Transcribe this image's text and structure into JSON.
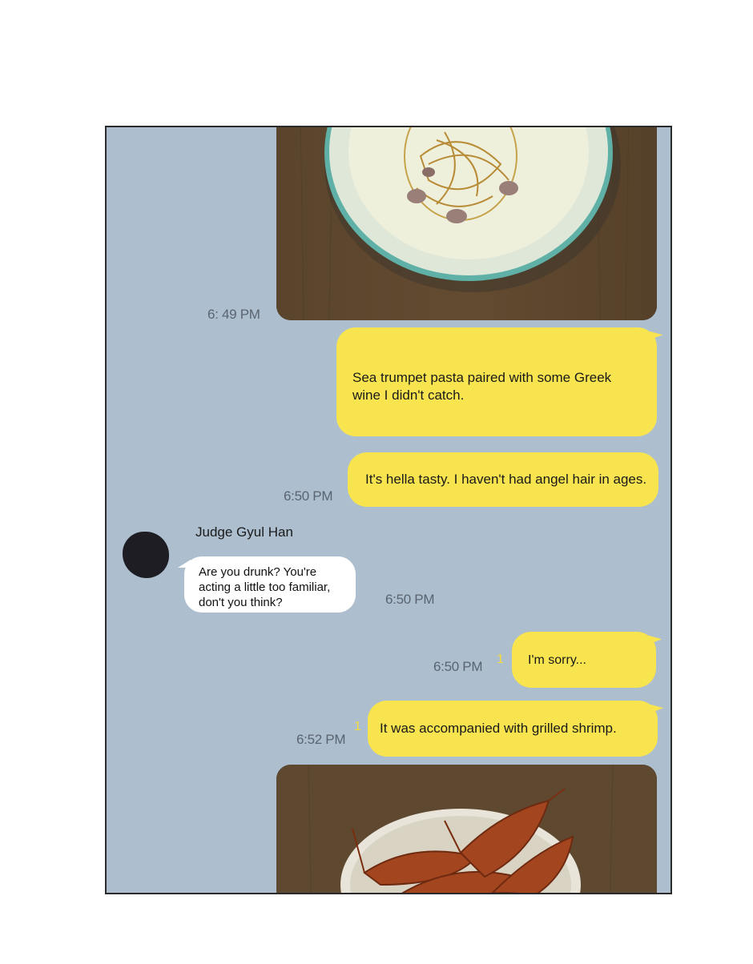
{
  "chat": {
    "messages": [
      {
        "type": "image",
        "sender": "me",
        "time": "6: 49 PM",
        "alt": "sea-trumpet-pasta-photo"
      },
      {
        "type": "text",
        "sender": "me",
        "text": "Sea trumpet pasta paired with some Greek wine I didn't catch."
      },
      {
        "type": "text",
        "sender": "me",
        "text": "It's hella tasty. I haven't had angel hair in ages.",
        "time": "6:50 PM"
      },
      {
        "type": "text",
        "sender": "Judge Gyul Han",
        "text": "Are you drunk? You're acting a little too familiar, don't you think?",
        "time": "6:50 PM"
      },
      {
        "type": "text",
        "sender": "me",
        "text": "I'm sorry...",
        "time": "6:50 PM",
        "unread": "1"
      },
      {
        "type": "text",
        "sender": "me",
        "text": "It was accompanied with grilled shrimp.",
        "time": "6:52 PM",
        "unread": "1"
      },
      {
        "type": "image",
        "sender": "me",
        "alt": "grilled-shrimp-photo"
      }
    ]
  },
  "contact": {
    "name": "Judge Gyul Han"
  },
  "colors": {
    "background": "#adbfcf",
    "my_bubble": "#f8e44e",
    "their_bubble": "#ffffff",
    "unread": "#f3da3a"
  },
  "icons": {
    "avatar": "avatar-placeholder"
  }
}
